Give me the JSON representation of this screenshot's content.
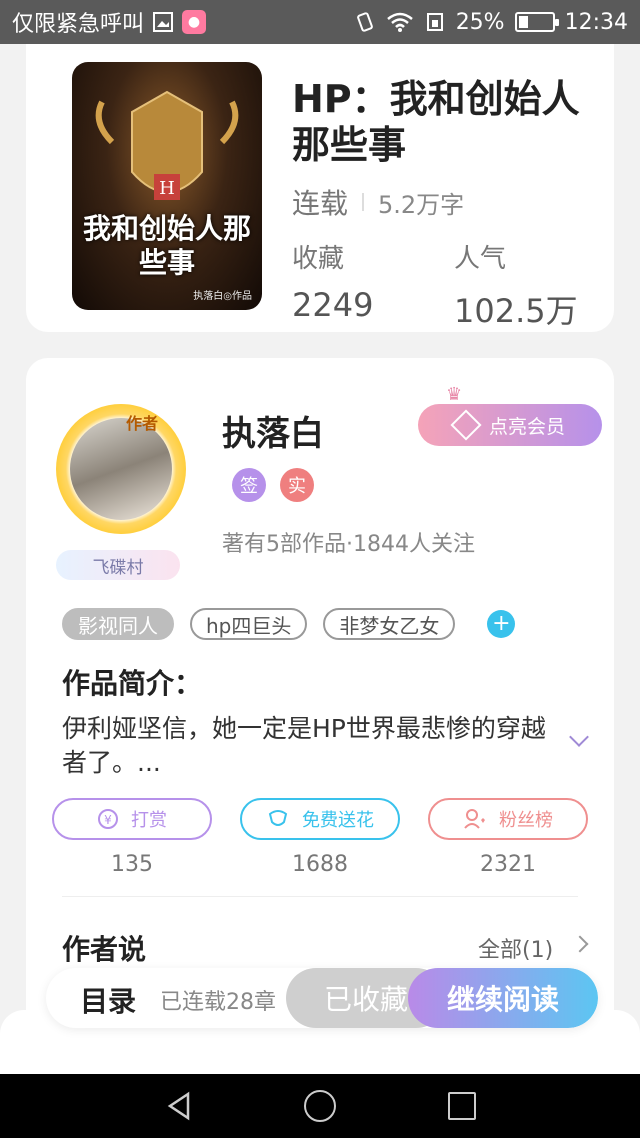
{
  "status_bar": {
    "left_text": "仅限紧急呼叫",
    "battery_text": "25%",
    "time": "12:34"
  },
  "book": {
    "cover_title": "我和创始人那些事",
    "cover_author": "执落白◎作品",
    "title": "HP：我和创始人那些事",
    "status": "连载",
    "word_count": "5.2万字",
    "stats": {
      "favorites_label": "收藏",
      "favorites_value": "2249",
      "popularity_label": "人气",
      "popularity_value": "102.5万"
    }
  },
  "author": {
    "avatar_tag": "作者",
    "village_badge": "飞碟村",
    "name": "执落白",
    "vip_label": "点亮会员",
    "badges": [
      "签",
      "实"
    ],
    "stats_text": "著有5部作品·1844人关注"
  },
  "tags": [
    "影视同人",
    "hp四巨头",
    "非梦女乙女"
  ],
  "intro": {
    "title": "作品简介：",
    "text": "伊利娅坚信，她一定是HP世界最悲惨的穿越者了。..."
  },
  "actions": [
    {
      "label": "打赏",
      "count": "135",
      "color": "#b691ea"
    },
    {
      "label": "免费送花",
      "count": "1688",
      "color": "#39c2ec"
    },
    {
      "label": "粉丝榜",
      "count": "2321",
      "color": "#ef8f8f"
    }
  ],
  "author_says": {
    "title": "作者说",
    "all_label": "全部(1)"
  },
  "bottom_bar": {
    "toc_label": "目录",
    "toc_count": "已连载28章",
    "collected_label": "已收藏",
    "read_label": "继续阅读"
  }
}
